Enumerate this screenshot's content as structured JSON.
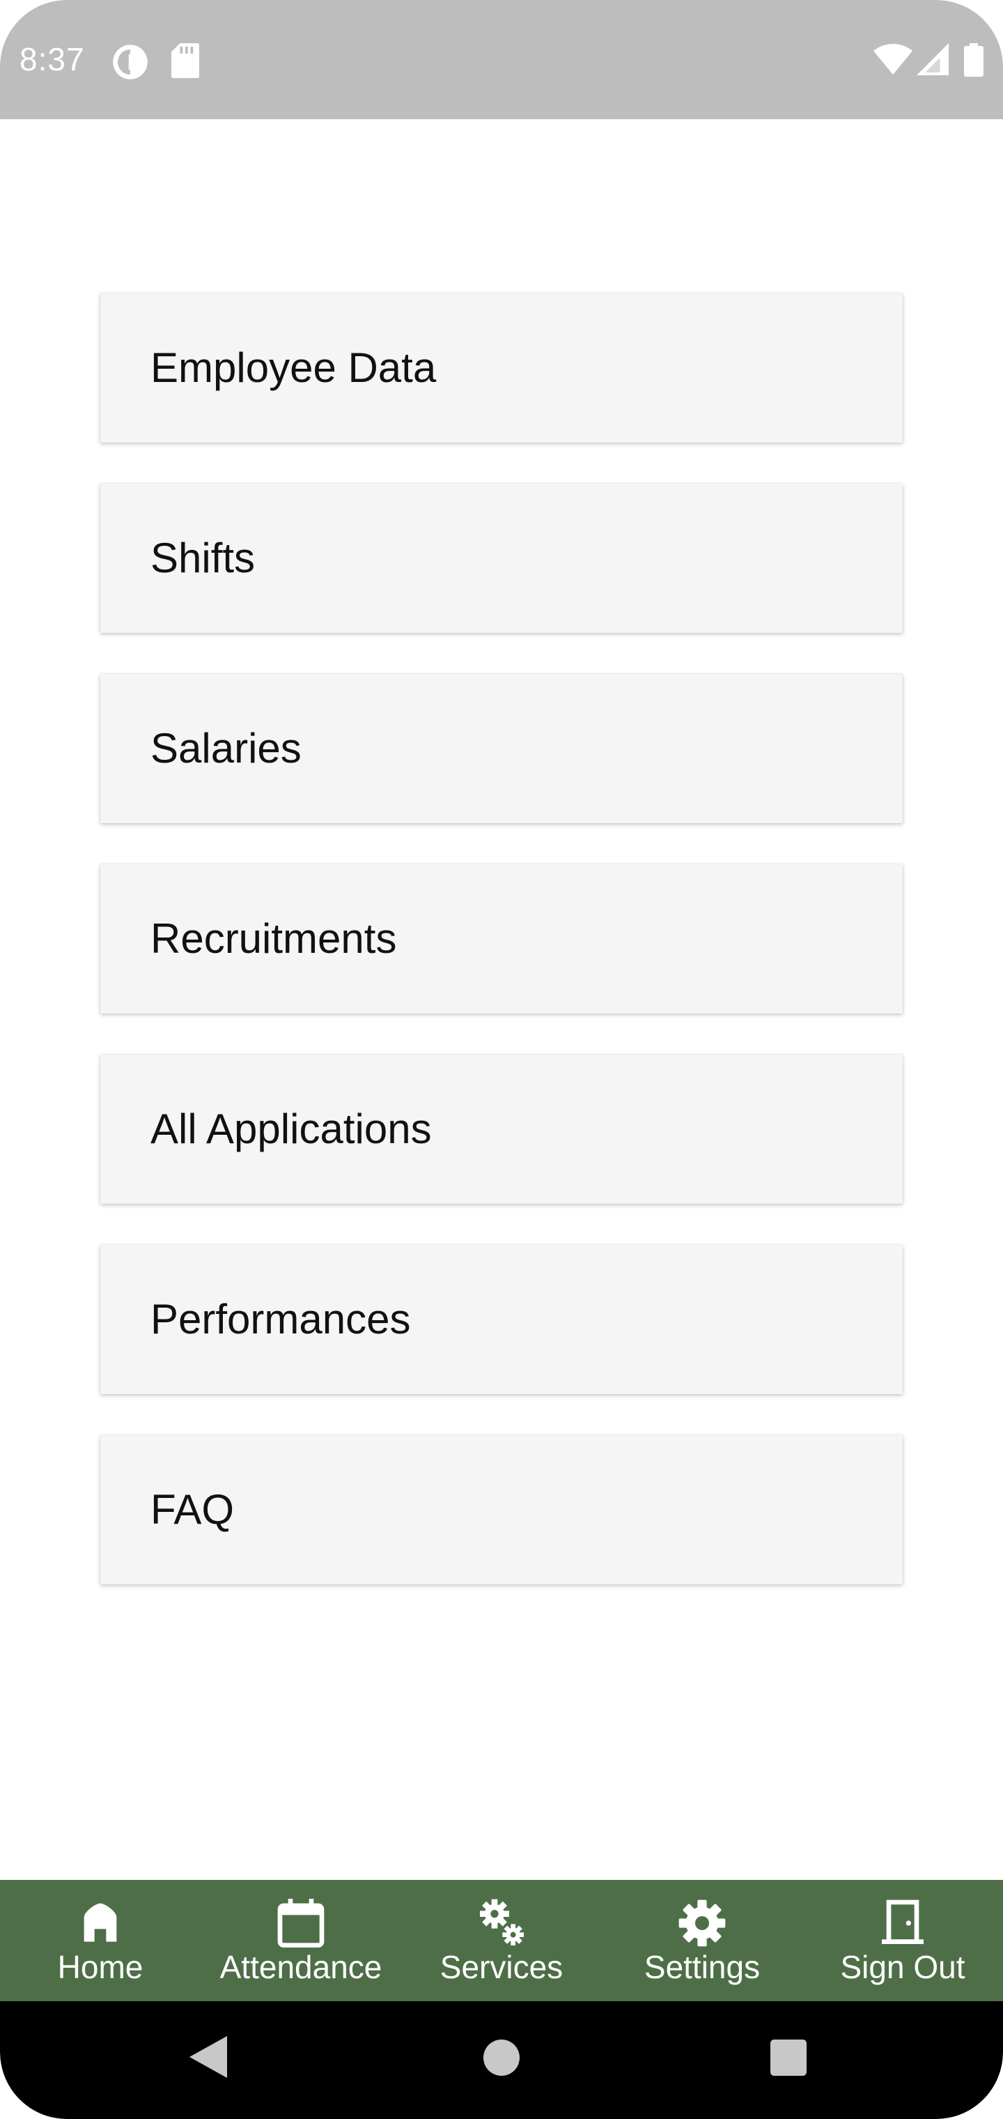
{
  "status_bar": {
    "time": "8:37",
    "left_icons": [
      "data-saver-icon",
      "sd-card-icon"
    ],
    "right_icons": [
      "wifi-icon",
      "cell-signal-icon",
      "battery-icon"
    ],
    "background": "#bdbdbd"
  },
  "menu": {
    "items": [
      {
        "label": "Employee Data"
      },
      {
        "label": "Shifts"
      },
      {
        "label": "Salaries"
      },
      {
        "label": "Recruitments"
      },
      {
        "label": "All Applications"
      },
      {
        "label": "Performances"
      },
      {
        "label": "FAQ"
      }
    ],
    "card_color": "#f5f5f5"
  },
  "bottom_nav": {
    "background": "#4e6e48",
    "items": [
      {
        "label": "Home",
        "icon": "home-icon"
      },
      {
        "label": "Attendance",
        "icon": "calendar-icon"
      },
      {
        "label": "Services",
        "icon": "gears-icon"
      },
      {
        "label": "Settings",
        "icon": "gear-icon"
      },
      {
        "label": "Sign Out",
        "icon": "door-icon"
      }
    ]
  },
  "system_nav": {
    "buttons": [
      "back-icon",
      "home-circle-icon",
      "recents-icon"
    ]
  }
}
